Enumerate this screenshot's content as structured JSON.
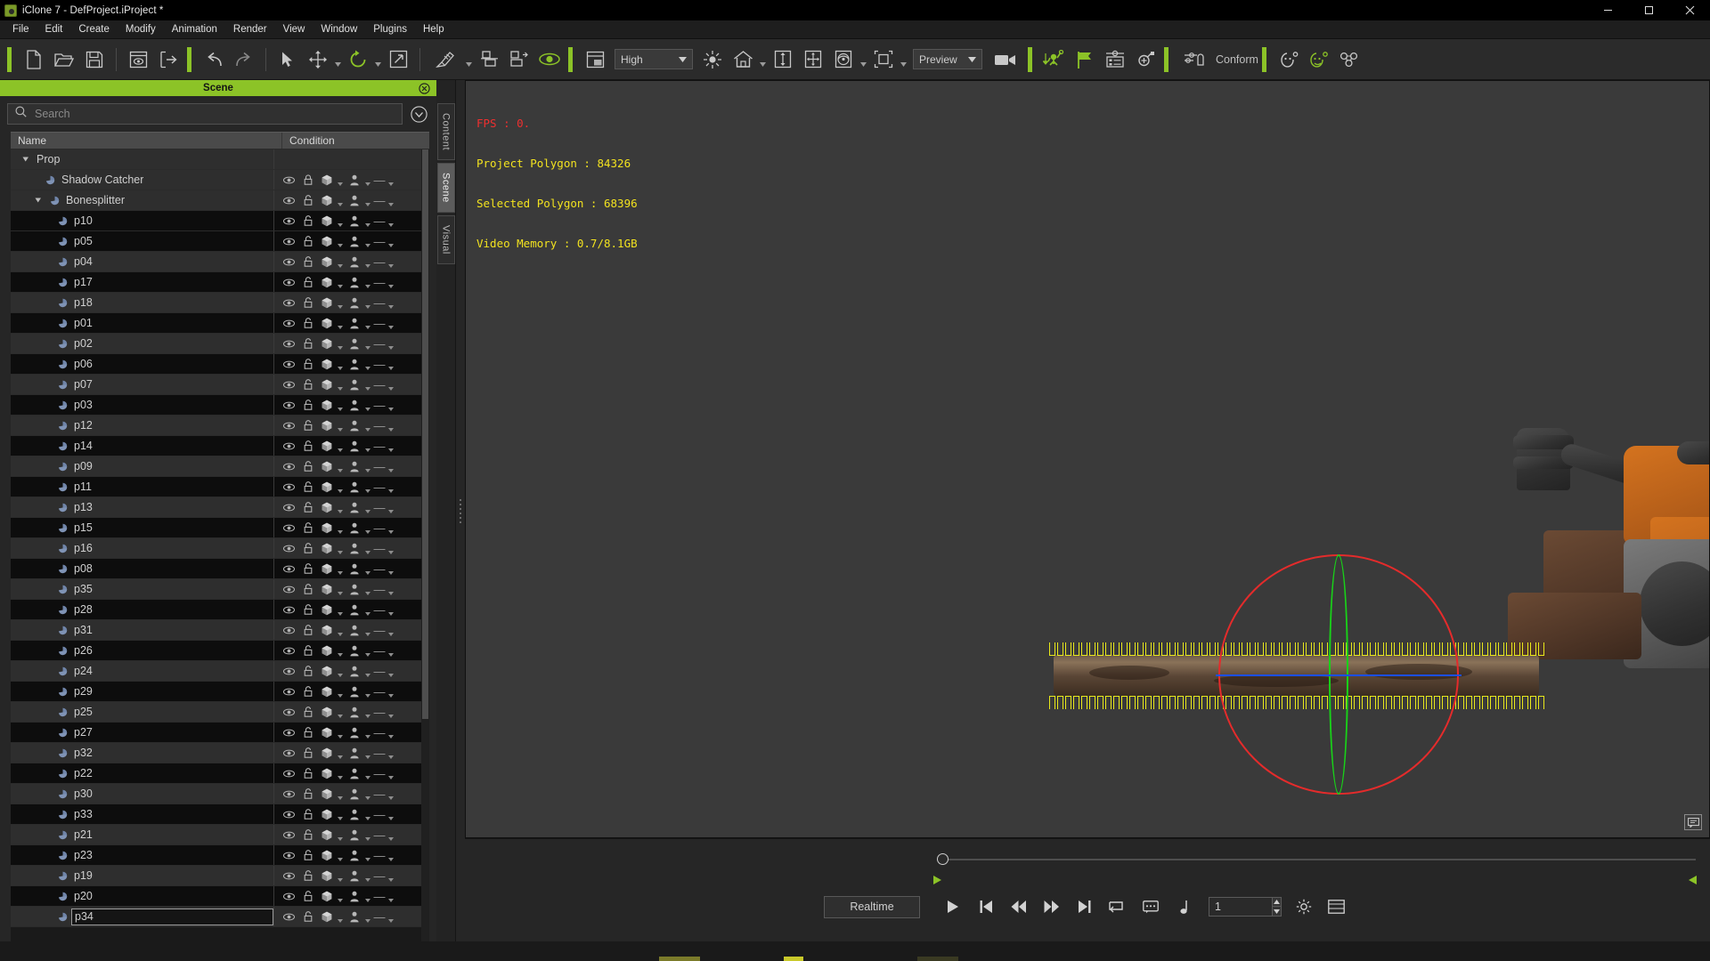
{
  "window": {
    "title": "iClone 7 - DefProject.iProject *",
    "logo_icon": "iclone-logo-icon",
    "minimize_label": "Minimize",
    "maximize_label": "Maximize",
    "close_label": "Close"
  },
  "menubar": {
    "items": [
      "File",
      "Edit",
      "Create",
      "Modify",
      "Animation",
      "Render",
      "View",
      "Window",
      "Plugins",
      "Help"
    ]
  },
  "toolbar": {
    "groups": [
      {
        "items": [
          {
            "icon": "new-project-icon",
            "label": "New"
          },
          {
            "icon": "open-folder-icon",
            "label": "Open"
          },
          {
            "icon": "save-floppy-icon",
            "label": "Save"
          }
        ]
      },
      {
        "items": [
          {
            "icon": "preview-window-icon",
            "label": "Preview Window"
          },
          {
            "icon": "export-arrow-icon",
            "label": "Export"
          }
        ]
      },
      {
        "items": [
          {
            "icon": "undo-icon",
            "label": "Undo"
          },
          {
            "icon": "redo-icon",
            "label": "Redo"
          }
        ]
      },
      {
        "items": [
          {
            "icon": "select-arrow-icon",
            "label": "Select"
          },
          {
            "icon": "move-icon",
            "label": "Move",
            "caret": true
          },
          {
            "icon": "rotate-icon",
            "label": "Rotate",
            "caret": true
          },
          {
            "icon": "scale-icon",
            "label": "Scale"
          }
        ]
      },
      {
        "items": [
          {
            "icon": "edit-pivot-icon",
            "label": "Edit Pivot",
            "caret": true
          },
          {
            "icon": "align-bottom-icon",
            "label": "Align"
          },
          {
            "icon": "align-distribute-icon",
            "label": "Distribute"
          },
          {
            "icon": "eye-visibility-icon",
            "label": "Show / Hide"
          }
        ]
      },
      {
        "items": [
          {
            "icon": "viewport-layout-icon",
            "label": "Viewport Layout"
          }
        ]
      }
    ],
    "quality_select": {
      "value": "High",
      "caret_icon": "chevron-down-icon"
    },
    "lighting_items": [
      {
        "icon": "sun-light-icon",
        "label": "Light"
      },
      {
        "icon": "home-reset-icon",
        "label": "Home",
        "caret": true
      },
      {
        "icon": "ground-height-icon",
        "label": "Ground Height"
      },
      {
        "icon": "move-object-icon",
        "label": "Transform Tool"
      },
      {
        "icon": "physics-icon",
        "label": "Physics",
        "caret": true
      },
      {
        "icon": "bounding-box-icon",
        "label": "Bounding Box",
        "caret": true
      }
    ],
    "render_select": {
      "value": "Preview",
      "caret_icon": "chevron-down-icon"
    },
    "camera_items": [
      {
        "icon": "video-camera-icon",
        "label": "Render Movie"
      }
    ],
    "motion_items": [
      {
        "icon": "motion-puppet-icon",
        "label": "Motion Puppet"
      },
      {
        "icon": "flag-marker-icon",
        "label": "Marker"
      },
      {
        "icon": "timeline-settings-icon",
        "label": "Timeline"
      },
      {
        "icon": "attach-link-icon",
        "label": "Attach"
      }
    ],
    "conform": {
      "icon": "conform-shirt-icon",
      "label": "Conform"
    },
    "end_items": [
      {
        "icon": "face-puppet-icon",
        "label": "Face Puppet"
      },
      {
        "icon": "face-key-icon",
        "label": "Face Key"
      },
      {
        "icon": "motion-live-icon",
        "label": "Motion Live"
      }
    ]
  },
  "left_panel": {
    "header_title": "Scene",
    "close_icon": "close-circle-icon",
    "search": {
      "placeholder": "Search",
      "value": "",
      "icon": "search-icon"
    },
    "search_options_icon": "chevron-down-circle-icon",
    "columns": {
      "name": "Name",
      "condition": "Condition"
    },
    "tree": [
      {
        "label": "Prop",
        "depth": 0,
        "expanded": true,
        "type": "group",
        "has_condition": false,
        "striped": false
      },
      {
        "label": "Shadow Catcher",
        "depth": 2,
        "type": "prop",
        "has_condition": true,
        "locked": true,
        "striped": false
      },
      {
        "label": "Bonesplitter",
        "depth": 1,
        "expanded": true,
        "type": "prop",
        "has_condition": true,
        "locked": false,
        "striped": false
      },
      {
        "label": "p10",
        "depth": 3,
        "type": "prop",
        "has_condition": true,
        "locked": false,
        "striped": true
      },
      {
        "label": "p05",
        "depth": 3,
        "type": "prop",
        "has_condition": true,
        "locked": false,
        "striped": true
      },
      {
        "label": "p04",
        "depth": 3,
        "type": "prop",
        "has_condition": true,
        "locked": false,
        "striped": false
      },
      {
        "label": "p17",
        "depth": 3,
        "type": "prop",
        "has_condition": true,
        "locked": false,
        "striped": true
      },
      {
        "label": "p18",
        "depth": 3,
        "type": "prop",
        "has_condition": true,
        "locked": false,
        "striped": false
      },
      {
        "label": "p01",
        "depth": 3,
        "type": "prop",
        "has_condition": true,
        "locked": false,
        "striped": true
      },
      {
        "label": "p02",
        "depth": 3,
        "type": "prop",
        "has_condition": true,
        "locked": false,
        "striped": false
      },
      {
        "label": "p06",
        "depth": 3,
        "type": "prop",
        "has_condition": true,
        "locked": false,
        "striped": true
      },
      {
        "label": "p07",
        "depth": 3,
        "type": "prop",
        "has_condition": true,
        "locked": false,
        "striped": false
      },
      {
        "label": "p03",
        "depth": 3,
        "type": "prop",
        "has_condition": true,
        "locked": false,
        "striped": true
      },
      {
        "label": "p12",
        "depth": 3,
        "type": "prop",
        "has_condition": true,
        "locked": false,
        "striped": false
      },
      {
        "label": "p14",
        "depth": 3,
        "type": "prop",
        "has_condition": true,
        "locked": false,
        "striped": true
      },
      {
        "label": "p09",
        "depth": 3,
        "type": "prop",
        "has_condition": true,
        "locked": false,
        "striped": false
      },
      {
        "label": "p11",
        "depth": 3,
        "type": "prop",
        "has_condition": true,
        "locked": false,
        "striped": true
      },
      {
        "label": "p13",
        "depth": 3,
        "type": "prop",
        "has_condition": true,
        "locked": false,
        "striped": false
      },
      {
        "label": "p15",
        "depth": 3,
        "type": "prop",
        "has_condition": true,
        "locked": false,
        "striped": true
      },
      {
        "label": "p16",
        "depth": 3,
        "type": "prop",
        "has_condition": true,
        "locked": false,
        "striped": false
      },
      {
        "label": "p08",
        "depth": 3,
        "type": "prop",
        "has_condition": true,
        "locked": false,
        "striped": true
      },
      {
        "label": "p35",
        "depth": 3,
        "type": "prop",
        "has_condition": true,
        "locked": false,
        "striped": false
      },
      {
        "label": "p28",
        "depth": 3,
        "type": "prop",
        "has_condition": true,
        "locked": false,
        "striped": true
      },
      {
        "label": "p31",
        "depth": 3,
        "type": "prop",
        "has_condition": true,
        "locked": false,
        "striped": false
      },
      {
        "label": "p26",
        "depth": 3,
        "type": "prop",
        "has_condition": true,
        "locked": false,
        "striped": true
      },
      {
        "label": "p24",
        "depth": 3,
        "type": "prop",
        "has_condition": true,
        "locked": false,
        "striped": false
      },
      {
        "label": "p29",
        "depth": 3,
        "type": "prop",
        "has_condition": true,
        "locked": false,
        "striped": true
      },
      {
        "label": "p25",
        "depth": 3,
        "type": "prop",
        "has_condition": true,
        "locked": false,
        "striped": false
      },
      {
        "label": "p27",
        "depth": 3,
        "type": "prop",
        "has_condition": true,
        "locked": false,
        "striped": true
      },
      {
        "label": "p32",
        "depth": 3,
        "type": "prop",
        "has_condition": true,
        "locked": false,
        "striped": false
      },
      {
        "label": "p22",
        "depth": 3,
        "type": "prop",
        "has_condition": true,
        "locked": false,
        "striped": true
      },
      {
        "label": "p30",
        "depth": 3,
        "type": "prop",
        "has_condition": true,
        "locked": false,
        "striped": false
      },
      {
        "label": "p33",
        "depth": 3,
        "type": "prop",
        "has_condition": true,
        "locked": false,
        "striped": true
      },
      {
        "label": "p21",
        "depth": 3,
        "type": "prop",
        "has_condition": true,
        "locked": false,
        "striped": false
      },
      {
        "label": "p23",
        "depth": 3,
        "type": "prop",
        "has_condition": true,
        "locked": false,
        "striped": true
      },
      {
        "label": "p19",
        "depth": 3,
        "type": "prop",
        "has_condition": true,
        "locked": false,
        "striped": false
      },
      {
        "label": "p20",
        "depth": 3,
        "type": "prop",
        "has_condition": true,
        "locked": false,
        "striped": true
      },
      {
        "label": "p34",
        "depth": 3,
        "type": "prop",
        "has_condition": true,
        "locked": false,
        "striped": false,
        "editing": true
      }
    ]
  },
  "side_tabs": [
    {
      "label": "Content",
      "active": false
    },
    {
      "label": "Scene",
      "active": true
    },
    {
      "label": "Visual",
      "active": false
    }
  ],
  "viewport": {
    "stats": {
      "fps": "FPS : 0.",
      "project_polygon": "Project Polygon : 84326",
      "selected_polygon": "Selected Polygon : 68396",
      "video_memory": "Video Memory : 0.7/8.1GB"
    },
    "colors": {
      "fps": "#ef2f2f",
      "stats": "#f2e21f",
      "gizmo_x": "#e42b2b",
      "gizmo_y": "#18d318",
      "gizmo_z": "#1b4ff0",
      "chain_highlight": "#f2f21a",
      "background": "#3a3a3a"
    },
    "corner_button_icon": "viewport-note-icon"
  },
  "transport": {
    "mode_label": "Realtime",
    "buttons": [
      {
        "icon": "play-icon",
        "label": "Play"
      },
      {
        "icon": "skip-start-icon",
        "label": "Go To Start"
      },
      {
        "icon": "rewind-icon",
        "label": "Previous Frame"
      },
      {
        "icon": "fast-forward-icon",
        "label": "Next Frame"
      },
      {
        "icon": "skip-end-icon",
        "label": "Go To End"
      },
      {
        "icon": "loop-icon",
        "label": "Loop"
      },
      {
        "icon": "subtitle-icon",
        "label": "Subtitle"
      },
      {
        "icon": "audio-note-icon",
        "label": "Audio"
      }
    ],
    "frame": {
      "value": "1",
      "spinner_up_icon": "caret-up-icon",
      "spinner_down_icon": "caret-down-icon"
    },
    "trailing": [
      {
        "icon": "preferences-gear-icon",
        "label": "Preferences"
      },
      {
        "icon": "timeline-panel-icon",
        "label": "Timeline"
      }
    ]
  },
  "timeline": {
    "handle_icon": "timeline-handle-icon",
    "marker_left_icon": "range-marker-left-icon",
    "marker_right_icon": "range-marker-right-icon"
  }
}
